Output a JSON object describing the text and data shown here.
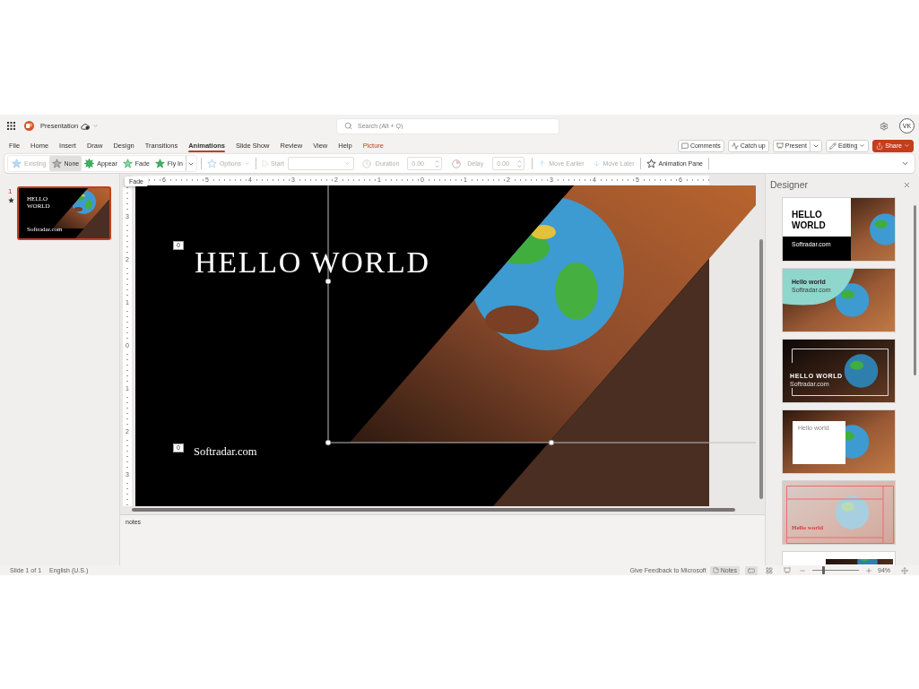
{
  "title_bar": {
    "document_title": "Presentation",
    "search": {
      "placeholder": "Search (Alt + Q)"
    },
    "user_initials": "VK"
  },
  "menu": {
    "tabs": [
      {
        "label": "File",
        "selected": false,
        "contextual": false
      },
      {
        "label": "Home",
        "selected": false,
        "contextual": false
      },
      {
        "label": "Insert",
        "selected": false,
        "contextual": false
      },
      {
        "label": "Draw",
        "selected": false,
        "contextual": false
      },
      {
        "label": "Design",
        "selected": false,
        "contextual": false
      },
      {
        "label": "Transitions",
        "selected": false,
        "contextual": false
      },
      {
        "label": "Animations",
        "selected": true,
        "contextual": false
      },
      {
        "label": "Slide Show",
        "selected": false,
        "contextual": false
      },
      {
        "label": "Review",
        "selected": false,
        "contextual": false
      },
      {
        "label": "View",
        "selected": false,
        "contextual": false
      },
      {
        "label": "Help",
        "selected": false,
        "contextual": false
      },
      {
        "label": "Picture",
        "selected": false,
        "contextual": true
      }
    ],
    "actions": [
      {
        "kind": "comments",
        "label": "Comments"
      },
      {
        "kind": "catchup",
        "label": "Catch up"
      },
      {
        "kind": "present",
        "label": "Present"
      },
      {
        "kind": "editing",
        "label": "Editing"
      },
      {
        "kind": "share",
        "label": "Share"
      }
    ]
  },
  "ribbon": {
    "effects": [
      {
        "kind": "existing",
        "label": "Existing",
        "selected": false,
        "disabled": true
      },
      {
        "kind": "none",
        "label": "None",
        "selected": true,
        "disabled": false
      },
      {
        "kind": "appear",
        "label": "Appear",
        "selected": false,
        "disabled": false
      },
      {
        "kind": "fade",
        "label": "Fade",
        "selected": false,
        "disabled": false
      },
      {
        "kind": "flyin",
        "label": "Fly In",
        "selected": false,
        "disabled": false
      }
    ],
    "effect_options": {
      "label": "Options",
      "disabled": true
    },
    "start": {
      "label": "Start",
      "disabled": true
    },
    "duration": {
      "label": "Duration",
      "value": "0.00",
      "disabled": true
    },
    "delay": {
      "label": "Delay",
      "value": "0.00",
      "disabled": true
    },
    "reorder": [
      {
        "kind": "earlier",
        "label": "Move Earlier",
        "disabled": true
      },
      {
        "kind": "later",
        "label": "Move Later",
        "disabled": true
      }
    ],
    "animation_pane": {
      "label": "Animation Pane",
      "disabled": false
    }
  },
  "tooltip": {
    "text": "Fade"
  },
  "slides_pane": {
    "slides": [
      {
        "number": "1",
        "selected": true,
        "animated": true,
        "title": "HELLO WORLD",
        "subtitle": "Softradar.com"
      }
    ]
  },
  "rulers": {
    "horizontal": [
      "6",
      "5",
      "4",
      "3",
      "2",
      "1",
      "0",
      "1",
      "2",
      "3",
      "4",
      "5",
      "6"
    ],
    "vertical": [
      "3",
      "2",
      "1",
      "0",
      "1",
      "2",
      "3"
    ]
  },
  "slide": {
    "title": {
      "text": "HELLO WORLD",
      "animation_order": "0"
    },
    "subtitle": {
      "text": "Softradar.com",
      "animation_order": "0"
    }
  },
  "notes": {
    "text": "notes"
  },
  "designer": {
    "title": "Designer",
    "designs": [
      {
        "kind": "split",
        "title": "HELLO WORLD",
        "subtitle": "Softradar.com"
      },
      {
        "kind": "gradient",
        "title": "Hello world",
        "subtitle": "Softradar.com"
      },
      {
        "kind": "framed",
        "title": "HELLO WORLD",
        "subtitle": "Softradar.com"
      },
      {
        "kind": "card",
        "title": "Hello world"
      },
      {
        "kind": "faded",
        "title": "Hello world"
      },
      {
        "kind": "banner"
      }
    ]
  },
  "status_bar": {
    "slide_position": "Slide 1 of 1",
    "language": "English (U.S.)",
    "feedback": "Give Feedback to Microsoft",
    "notes_button": {
      "label": "Notes",
      "selected": true
    },
    "views": [
      {
        "kind": "normal",
        "selected": true
      },
      {
        "kind": "sorter",
        "selected": false
      },
      {
        "kind": "presenter",
        "selected": false
      }
    ],
    "zoom": {
      "level": 0.23,
      "reading": "94%"
    }
  }
}
